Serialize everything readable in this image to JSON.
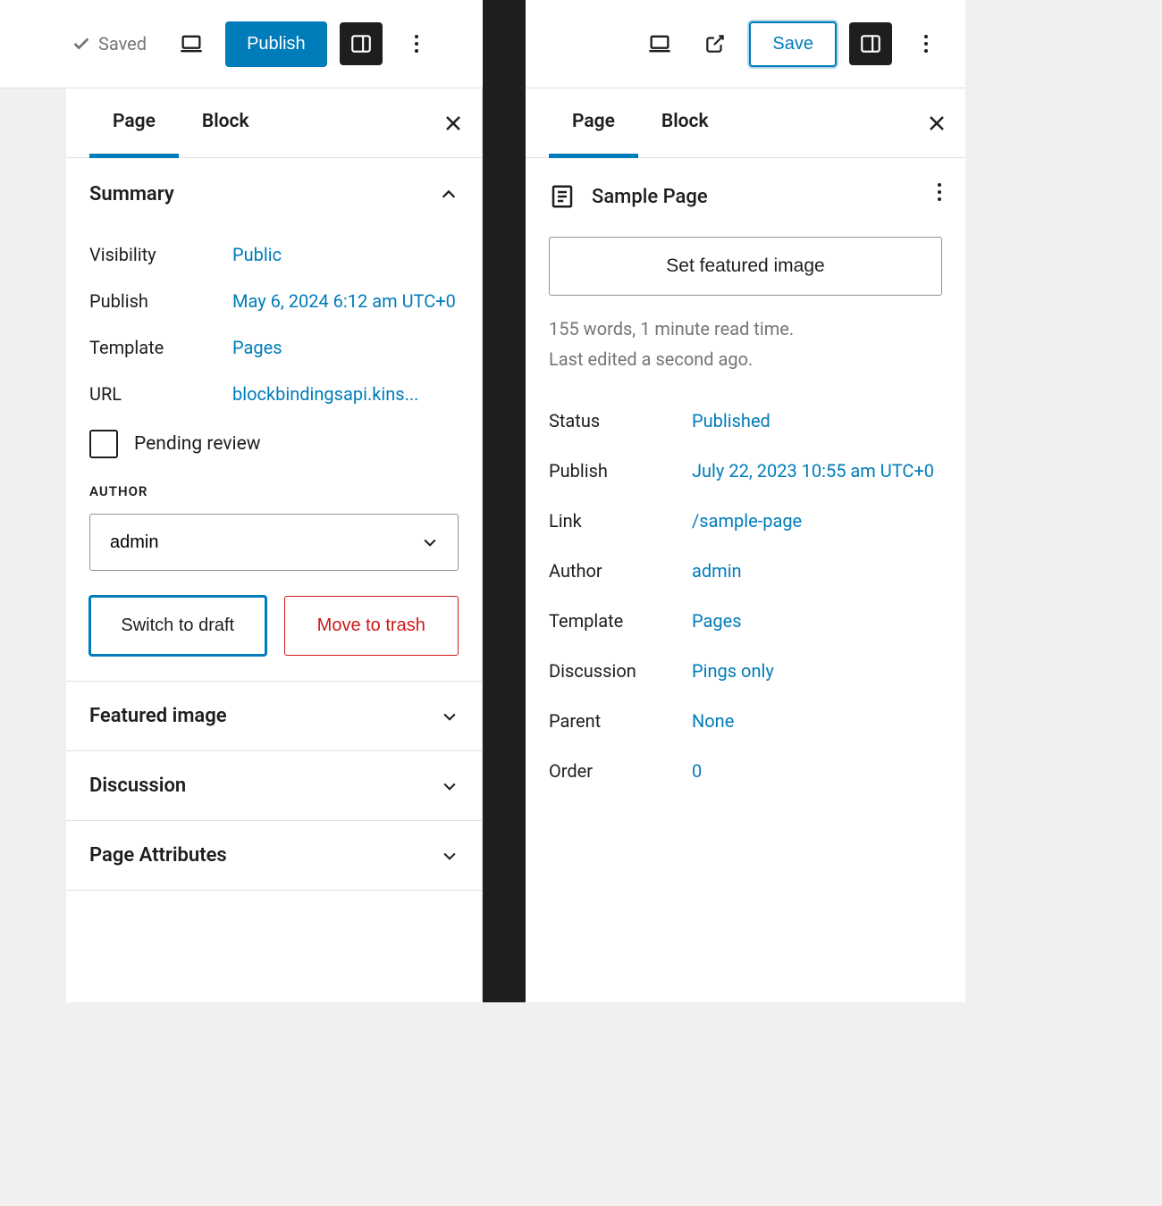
{
  "left": {
    "toolbar": {
      "saved": "Saved",
      "publish": "Publish"
    },
    "tabs": {
      "page": "Page",
      "block": "Block"
    },
    "summary": {
      "title": "Summary",
      "rows": {
        "visibility_k": "Visibility",
        "visibility_v": "Public",
        "publish_k": "Publish",
        "publish_v": "May 6, 2024 6:12 am UTC+0",
        "template_k": "Template",
        "template_v": "Pages",
        "url_k": "URL",
        "url_v": "blockbindingsapi.kins..."
      },
      "pending_review": "Pending review",
      "author_label": "AUTHOR",
      "author_value": "admin",
      "switch_draft": "Switch to draft",
      "move_trash": "Move to trash"
    },
    "sections": {
      "featured": "Featured image",
      "discussion": "Discussion",
      "attributes": "Page Attributes"
    }
  },
  "right": {
    "toolbar": {
      "save": "Save"
    },
    "tabs": {
      "page": "Page",
      "block": "Block"
    },
    "page_title": "Sample Page",
    "featured_btn": "Set featured image",
    "meta_line1": "155 words, 1 minute read time.",
    "meta_line2": "Last edited a second ago.",
    "rows": {
      "status_k": "Status",
      "status_v": "Published",
      "publish_k": "Publish",
      "publish_v": "July 22, 2023 10:55 am UTC+0",
      "link_k": "Link",
      "link_v": "/sample-page",
      "author_k": "Author",
      "author_v": "admin",
      "template_k": "Template",
      "template_v": "Pages",
      "discussion_k": "Discussion",
      "discussion_v": "Pings only",
      "parent_k": "Parent",
      "parent_v": "None",
      "order_k": "Order",
      "order_v": "0"
    }
  }
}
